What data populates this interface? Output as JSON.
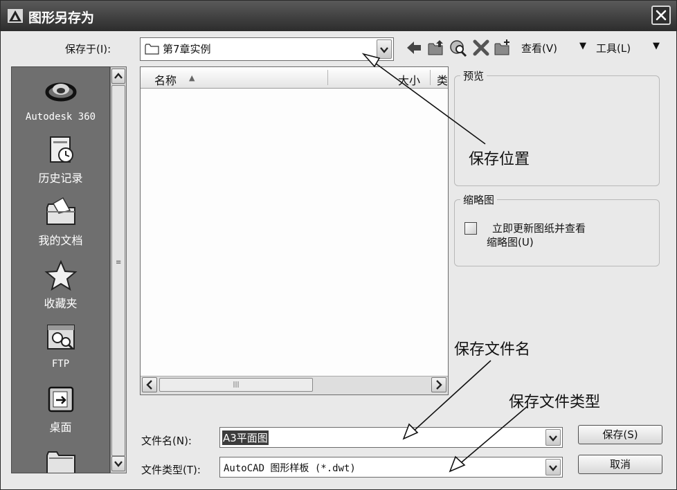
{
  "window": {
    "title": "图形另存为",
    "close_symbol": "✕"
  },
  "toolbar": {
    "save_in_label": "保存于(I):",
    "save_in_value": "第7章实例",
    "view_label": "查看(V)",
    "tools_label": "工具(L)",
    "icons": [
      "back-arrow-icon",
      "up-folder-icon",
      "search-web-icon",
      "delete-icon",
      "new-folder-icon"
    ]
  },
  "places": [
    {
      "label": "Autodesk 360",
      "icon": "autodesk-360-icon"
    },
    {
      "label": "历史记录",
      "icon": "history-icon"
    },
    {
      "label": "我的文档",
      "icon": "my-documents-icon"
    },
    {
      "label": "收藏夹",
      "icon": "favorites-star-icon"
    },
    {
      "label": "FTP",
      "icon": "ftp-icon"
    },
    {
      "label": "桌面",
      "icon": "desktop-icon"
    }
  ],
  "file_list": {
    "columns": [
      "名称",
      "大小",
      "类"
    ],
    "sort_indicator": "▲"
  },
  "preview": {
    "group_title": "预览"
  },
  "thumbnail": {
    "group_title": "缩略图",
    "checkbox_label_line1": "立即更新图纸并查看",
    "checkbox_label_line2": "缩略图(U)",
    "checked": false
  },
  "file_name": {
    "label": "文件名(N):",
    "value": "A3平面图"
  },
  "file_type": {
    "label": "文件类型(T):",
    "value": "AutoCAD 图形样板 (*.dwt)"
  },
  "buttons": {
    "save": "保存(S)",
    "cancel": "取消"
  },
  "annotations": {
    "save_location": "保存位置",
    "save_file_name": "保存文件名",
    "save_file_type": "保存文件类型"
  }
}
